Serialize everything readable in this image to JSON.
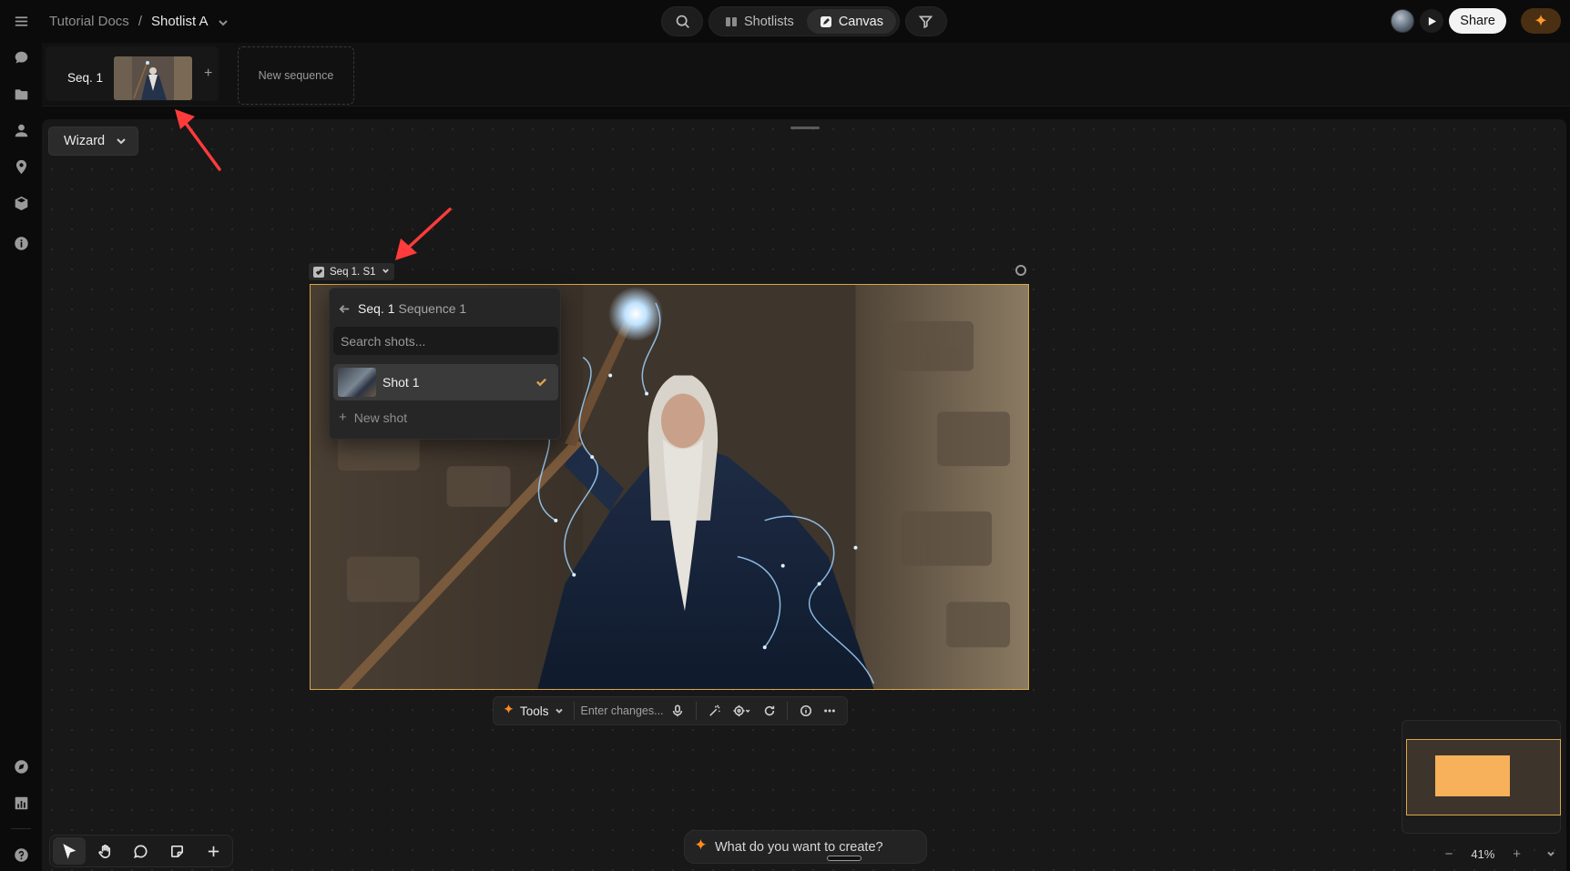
{
  "breadcrumb": {
    "root": "Tutorial Docs",
    "separator": "/",
    "current": "Shotlist A"
  },
  "view_toggle": {
    "shotlists": "Shotlists",
    "canvas": "Canvas",
    "active": "Canvas"
  },
  "header": {
    "share_label": "Share"
  },
  "sequences": {
    "current_label": "Seq. 1",
    "add_label": "+",
    "new_sequence_label": "New sequence"
  },
  "canvas": {
    "wizard_label": "Wizard",
    "shot_tag": "Seq 1. S1"
  },
  "shot_dropdown": {
    "seq_label": "Seq. 1",
    "seq_name": "Sequence 1",
    "search_placeholder": "Search shots...",
    "items": [
      {
        "label": "Shot 1",
        "selected": true
      }
    ],
    "new_shot_label": "New shot"
  },
  "tools_bar": {
    "tools_label": "Tools",
    "input_placeholder": "Enter changes..."
  },
  "prompt": {
    "placeholder": "What do you want to create?"
  },
  "zoom": {
    "level": "41%"
  },
  "colors": {
    "accent": "#d9a54b",
    "spark": "#ff8a1f",
    "minimap_shot": "#f6b15a",
    "arrow": "#ff3b3b"
  }
}
